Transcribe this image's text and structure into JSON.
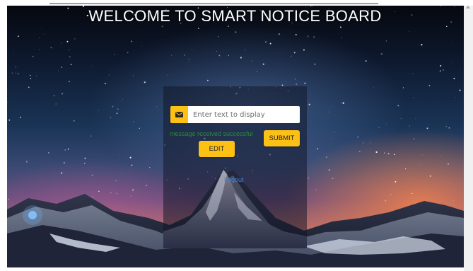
{
  "page": {
    "title": "WELCOME TO SMART NOTICE BOARD"
  },
  "form": {
    "input_placeholder": "Enter text to display",
    "input_value": "",
    "input_icon": "envelope-icon",
    "status_message": "message received successful",
    "submit_label": "SUBMIT",
    "edit_label": "EDIT",
    "logout_label": "Logout"
  },
  "colors": {
    "accent": "#fdc014",
    "status_text": "#2a8a3a",
    "link": "#3a86e8",
    "title_text": "#ffffff"
  },
  "background": {
    "image": "starry night sky over snowy mountains"
  }
}
